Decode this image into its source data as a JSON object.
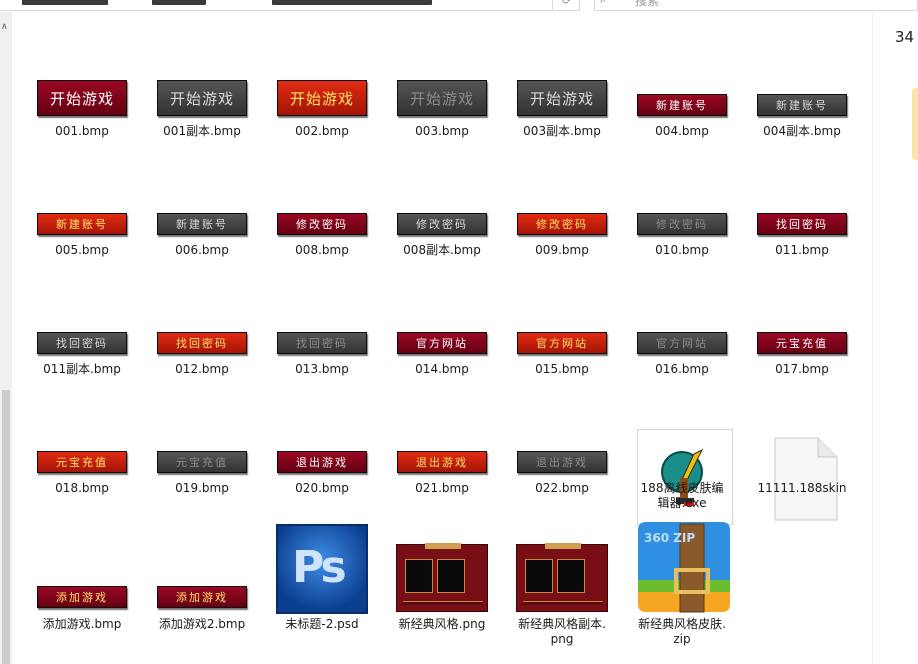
{
  "toolbar": {
    "search_placeholder": "搜索"
  },
  "right_panel": {
    "count_text": "34"
  },
  "files": [
    {
      "name": "001.bmp",
      "kind": "bmp-big",
      "style": "red",
      "label": "开始游戏"
    },
    {
      "name": "001副本.bmp",
      "kind": "bmp-big",
      "style": "gray",
      "label": "开始游戏"
    },
    {
      "name": "002.bmp",
      "kind": "bmp-big",
      "style": "orange",
      "label": "开始游戏"
    },
    {
      "name": "003.bmp",
      "kind": "bmp-big",
      "style": "gray-dim",
      "label": "开始游戏"
    },
    {
      "name": "003副本.bmp",
      "kind": "bmp-big",
      "style": "gray",
      "label": "开始游戏"
    },
    {
      "name": "004.bmp",
      "kind": "bmp-small",
      "style": "red",
      "label": "新建账号"
    },
    {
      "name": "004副本.bmp",
      "kind": "bmp-small",
      "style": "gray",
      "label": "新建账号"
    },
    {
      "name": "005.bmp",
      "kind": "bmp-small",
      "style": "orange",
      "label": "新建账号"
    },
    {
      "name": "006.bmp",
      "kind": "bmp-small",
      "style": "gray",
      "label": "新建账号"
    },
    {
      "name": "008.bmp",
      "kind": "bmp-small",
      "style": "red",
      "label": "修改密码"
    },
    {
      "name": "008副本.bmp",
      "kind": "bmp-small",
      "style": "gray",
      "label": "修改密码"
    },
    {
      "name": "009.bmp",
      "kind": "bmp-small",
      "style": "orange",
      "label": "修改密码"
    },
    {
      "name": "010.bmp",
      "kind": "bmp-small",
      "style": "gray-dim",
      "label": "修改密码"
    },
    {
      "name": "011.bmp",
      "kind": "bmp-small",
      "style": "red",
      "label": "找回密码"
    },
    {
      "name": "011副本.bmp",
      "kind": "bmp-small",
      "style": "gray",
      "label": "找回密码"
    },
    {
      "name": "012.bmp",
      "kind": "bmp-small",
      "style": "orange",
      "label": "找回密码"
    },
    {
      "name": "013.bmp",
      "kind": "bmp-small",
      "style": "gray-dim",
      "label": "找回密码"
    },
    {
      "name": "014.bmp",
      "kind": "bmp-small",
      "style": "red",
      "label": "官方网站"
    },
    {
      "name": "015.bmp",
      "kind": "bmp-small",
      "style": "orange",
      "label": "官方网站"
    },
    {
      "name": "016.bmp",
      "kind": "bmp-small",
      "style": "gray-dim",
      "label": "官方网站"
    },
    {
      "name": "017.bmp",
      "kind": "bmp-small",
      "style": "red",
      "label": "元宝充值"
    },
    {
      "name": "018.bmp",
      "kind": "bmp-small",
      "style": "orange",
      "label": "元宝充值"
    },
    {
      "name": "019.bmp",
      "kind": "bmp-small",
      "style": "gray-dim",
      "label": "元宝充值"
    },
    {
      "name": "020.bmp",
      "kind": "bmp-small",
      "style": "red",
      "label": "退出游戏"
    },
    {
      "name": "021.bmp",
      "kind": "bmp-small",
      "style": "orange",
      "label": "退出游戏"
    },
    {
      "name": "022.bmp",
      "kind": "bmp-small",
      "style": "gray-dim",
      "label": "退出游戏"
    },
    {
      "name": "188离线皮肤编辑器.exe",
      "display": "188离线皮肤编\n辑器.exe",
      "kind": "exe"
    },
    {
      "name": "11111.188skin",
      "kind": "doc"
    },
    {
      "name": "添加游戏.bmp",
      "kind": "bmp-small",
      "style": "red-y",
      "label": "添加游戏"
    },
    {
      "name": "添加游戏2.bmp",
      "kind": "bmp-small",
      "style": "red-y",
      "label": "添加游戏"
    },
    {
      "name": "未标题-2.psd",
      "kind": "psd",
      "label": "Ps"
    },
    {
      "name": "新经典风格.png",
      "kind": "skin"
    },
    {
      "name": "新经典风格副本.png",
      "display": "新经典风格副本.\npng",
      "kind": "skin"
    },
    {
      "name": "新经典风格皮肤.zip",
      "display": "新经典风格皮肤.\nzip",
      "kind": "zip",
      "label": "360 ZIP"
    }
  ]
}
